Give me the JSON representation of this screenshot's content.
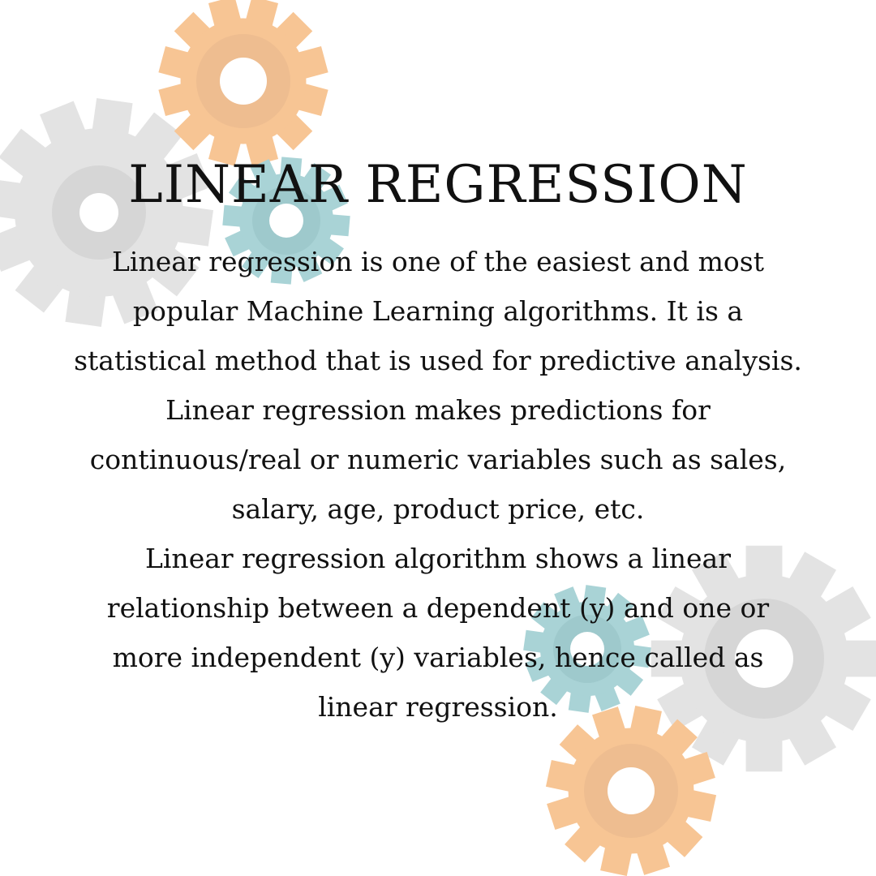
{
  "title": "LINEAR REGRESSION",
  "paragraph_1": "Linear regression is one of the easiest and most popular Machine Learning algorithms. It is a statistical method that is used for predictive analysis. Linear regression makes predictions for continuous/real or numeric variables such as sales, salary, age, product price, etc.",
  "paragraph_2": "Linear regression algorithm shows a linear relationship between a dependent (y) and one or more independent (y) variables, hence called as linear regression.",
  "icons": [
    "gear-icon"
  ],
  "colors": {
    "gear_orange": "#f7c594",
    "gear_orange_inner": "#eebd90",
    "gear_gray": "#e3e3e3",
    "gear_gray_inner": "#d6d6d6",
    "gear_teal": "#a9d3d6",
    "gear_teal_inner": "#9ec9cc",
    "text": "#111111",
    "background": "#ffffff"
  }
}
